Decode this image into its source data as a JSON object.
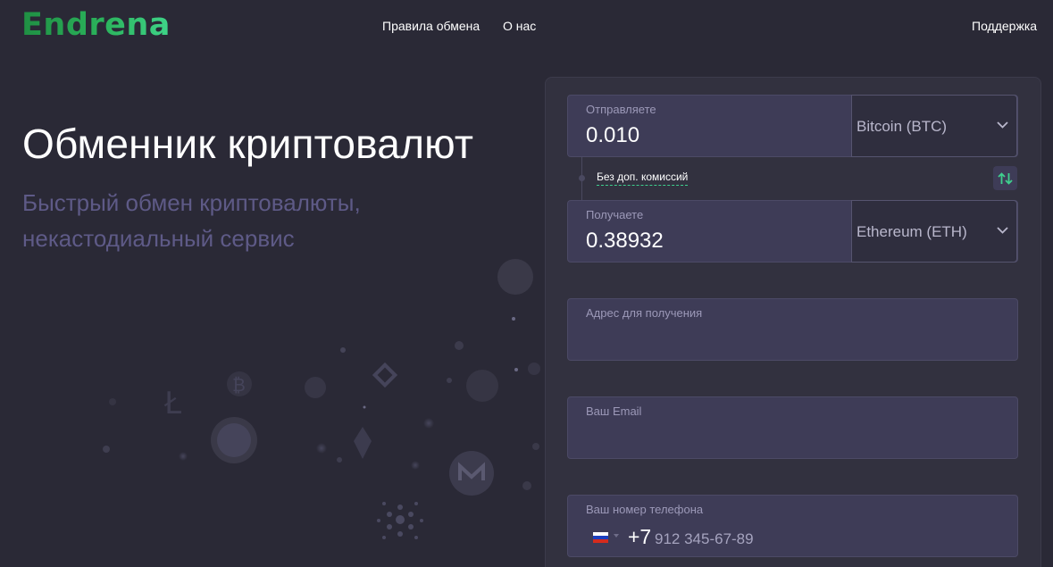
{
  "header": {
    "logo": "Endrena",
    "nav": [
      "Правила обмена",
      "О нас"
    ],
    "support": "Поддержка"
  },
  "hero": {
    "title": "Обменник криптовалют",
    "subtitle": "Быстрый обмен криптовалюты, некастодиальный сервис"
  },
  "exchange": {
    "send": {
      "label": "Отправляете",
      "amount": "0.010",
      "currency": "Bitcoin (BTC)"
    },
    "commission": "Без доп. комиссий",
    "receive": {
      "label": "Получаете",
      "amount": "0.38932",
      "currency": "Ethereum (ETH)"
    },
    "address": {
      "label": "Адрес для получения",
      "value": ""
    },
    "email": {
      "label": "Ваш Email",
      "value": ""
    },
    "phone": {
      "label": "Ваш номер телефона",
      "code": "+7",
      "placeholder": "912 345-67-89"
    }
  },
  "icons": {
    "swap": "swap-arrows-icon",
    "chevron": "chevron-down-icon",
    "flag": "russia-flag-icon"
  },
  "colors": {
    "background": "#2a2936",
    "card": "#32313f",
    "field": "#3e3c57",
    "accent_green": "#3fcf8e",
    "subtitle": "#5e5a87"
  }
}
